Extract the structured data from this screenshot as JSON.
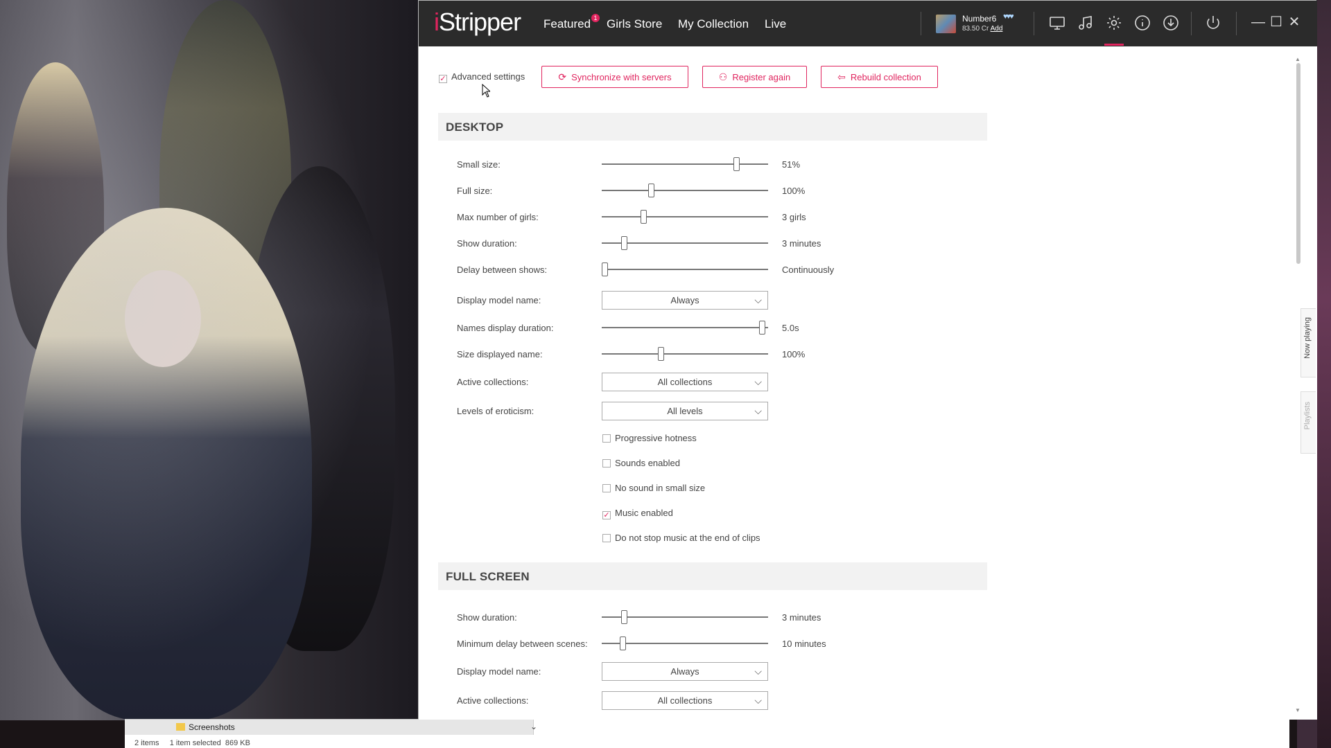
{
  "app": {
    "logo_prefix": "i",
    "logo_rest": "Stripper",
    "nav": [
      "Featured",
      "Girls Store",
      "My Collection",
      "Live"
    ],
    "featured_badge": "1",
    "user": {
      "name": "Number6",
      "credits": "83.50 Cr",
      "add_label": "Add",
      "hearts": "♥♥♥"
    },
    "icons": [
      "desktop-icon",
      "music-icon",
      "gear-icon",
      "info-icon",
      "download-icon",
      "power-icon"
    ],
    "window_controls": {
      "minimize": "—",
      "maximize": "☐",
      "close": "✕"
    },
    "accent": "#e0245e"
  },
  "toolbar": {
    "advanced_label": "Advanced settings",
    "advanced_checked": "✓",
    "sync_label": "Synchronize with servers",
    "register_label": "Register again",
    "rebuild_label": "Rebuild collection"
  },
  "desktop": {
    "title": "DESKTOP",
    "sliders": [
      {
        "label": "Small size:",
        "value": "51%",
        "level": 0.82
      },
      {
        "label": "Full size:",
        "value": "100%",
        "level": 0.29
      },
      {
        "label": "Max number of girls:",
        "value": "3 girls",
        "level": 0.24
      },
      {
        "label": "Show duration:",
        "value": "3 minutes",
        "level": 0.12
      },
      {
        "label": "Delay between shows:",
        "value": "Continuously",
        "level": 0.0
      }
    ],
    "display_name": {
      "label": "Display model name:",
      "value": "Always"
    },
    "names_duration": {
      "label": "Names display duration:",
      "value": "5.0s",
      "level": 0.98
    },
    "size_name": {
      "label": "Size displayed name:",
      "value": "100%",
      "level": 0.35
    },
    "active_collections": {
      "label": "Active collections:",
      "value": "All collections"
    },
    "eroticism": {
      "label": "Levels of eroticism:",
      "value": "All levels"
    },
    "checkboxes": [
      {
        "label": "Progressive hotness",
        "checked": false
      },
      {
        "label": "Sounds enabled",
        "checked": false
      },
      {
        "label": "No sound in small size",
        "checked": false
      },
      {
        "label": "Music enabled",
        "checked": true
      },
      {
        "label": "Do not stop music at the end of clips",
        "checked": false
      }
    ]
  },
  "fullscreen": {
    "title": "FULL SCREEN",
    "show_duration": {
      "label": "Show duration:",
      "value": "3 minutes",
      "level": 0.12
    },
    "min_delay": {
      "label": "Minimum delay between scenes:",
      "value": "10 minutes",
      "level": 0.11
    },
    "display_name": {
      "label": "Display model name:",
      "value": "Always"
    },
    "active_collections": {
      "label": "Active collections:",
      "value": "All collections"
    }
  },
  "side_tabs": {
    "now_playing": "Now playing",
    "playlists": "Playlists"
  },
  "explorer": {
    "folder": "Screenshots",
    "status": "2 items     1 item selected  869 KB"
  }
}
